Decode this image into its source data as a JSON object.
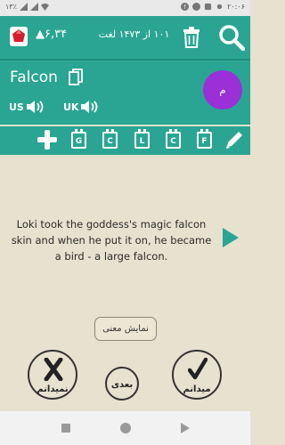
{
  "status": {
    "time": "۲۰:۰۶",
    "battery": "۱۳٪"
  },
  "header": {
    "score": "۶,۳۴",
    "counter": "۱۰۱ از ۱۴۷۳ لغت"
  },
  "word": {
    "text": "Falcon",
    "us_label": "US",
    "uk_label": "UK",
    "avatar_text": "م"
  },
  "tools": {
    "boxes": [
      "G",
      "C",
      "L",
      "C",
      "F"
    ]
  },
  "card": {
    "sentence": "Loki took the goddess's magic falcon skin and when he put it on, he became a bird - a large falcon."
  },
  "actions": {
    "show_meaning": "نمایش معنی",
    "dont_know": "نمیدانم",
    "next": "بعدی",
    "know": "میدانم"
  },
  "colors": {
    "teal": "#2aa593",
    "avatar": "#9b2fd8",
    "background": "#e7e1cf"
  }
}
